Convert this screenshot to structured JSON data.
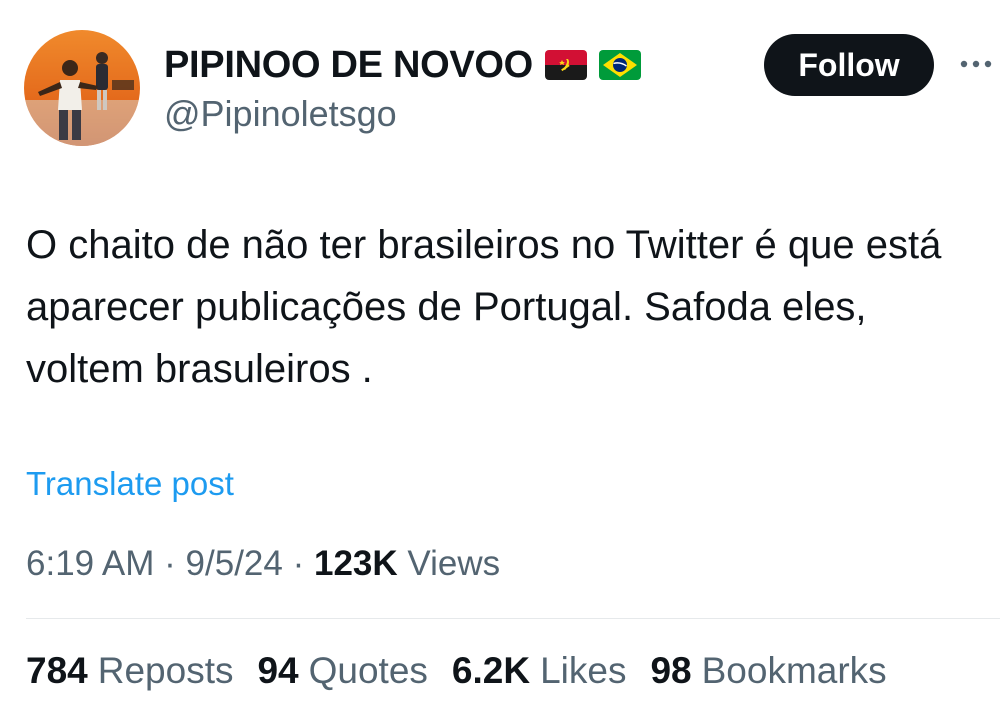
{
  "author": {
    "display_name": "PIPINOO DE NOVOO",
    "handle": "@Pipinoletsgo",
    "flags": [
      "angola-flag-icon",
      "brazil-flag-icon"
    ]
  },
  "follow_label": "Follow",
  "tweet_text": "O chaito de não ter brasileiros no Twitter é que está aparecer publicações de Portugal. Safoda eles, voltem brasuleiros .",
  "translate_label": "Translate post",
  "meta": {
    "time": "6:19 AM",
    "date": "9/5/24",
    "separator": "·",
    "views_count": "123K",
    "views_label": "Views"
  },
  "stats": {
    "reposts": {
      "count": "784",
      "label": "Reposts"
    },
    "quotes": {
      "count": "94",
      "label": "Quotes"
    },
    "likes": {
      "count": "6.2K",
      "label": "Likes"
    },
    "bookmarks": {
      "count": "98",
      "label": "Bookmarks"
    }
  },
  "colors": {
    "text": "#0f1419",
    "secondary": "#536471",
    "link": "#1d9bf0",
    "button_bg": "#0f1419"
  }
}
